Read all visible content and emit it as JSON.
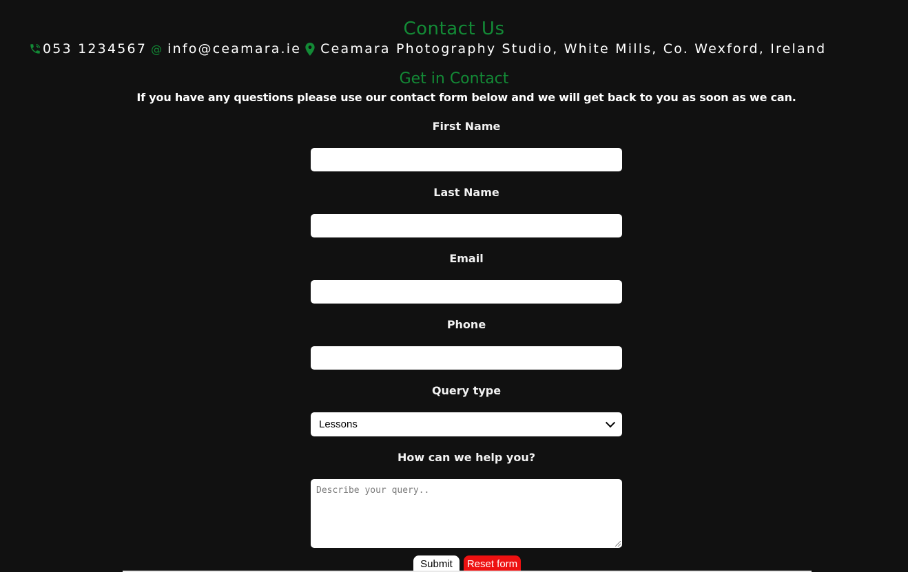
{
  "header": {
    "title": "Contact Us",
    "phone": "053 1234567",
    "email": "info@ceamara.ie",
    "address": "Ceamara Photography Studio, White Mills, Co. Wexford, Ireland",
    "icons": {
      "phone": "phone-icon",
      "email": "at-sign-icon",
      "address": "map-pin-icon"
    }
  },
  "contact_section": {
    "title": "Get in Contact",
    "intro": "If you have any questions please use our contact form below and we will get back to you as soon as we can."
  },
  "form": {
    "first_name": {
      "label": "First Name",
      "value": ""
    },
    "last_name": {
      "label": "Last Name",
      "value": ""
    },
    "email": {
      "label": "Email",
      "value": ""
    },
    "phone": {
      "label": "Phone",
      "value": ""
    },
    "query_type": {
      "label": "Query type",
      "selected": "Lessons"
    },
    "message": {
      "label": "How can we help you?",
      "placeholder": "Describe your query..",
      "value": ""
    },
    "submit_label": "Submit",
    "reset_label": "Reset form"
  },
  "colors": {
    "background": "#111111",
    "accent_green": "#138a36",
    "reset_red": "#ee1111",
    "text": "#ffffff"
  }
}
